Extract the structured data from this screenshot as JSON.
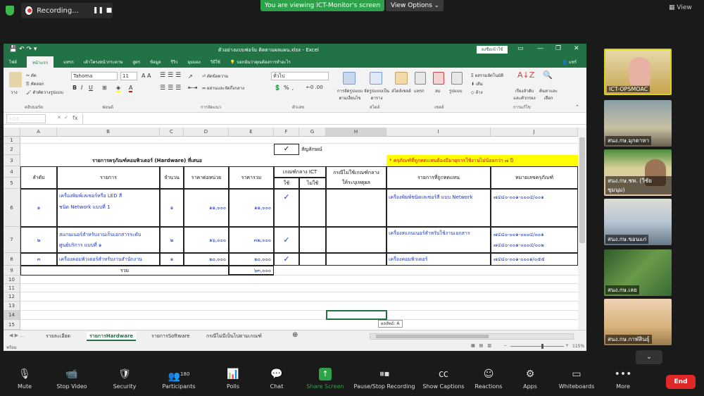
{
  "zoom": {
    "recording": "Recording...",
    "viewing_banner": "You are viewing ICT-Monitor's screen",
    "view_options": "View Options",
    "view_label": "View",
    "end": "End",
    "participants_count": "180"
  },
  "toolbar": [
    {
      "label": "Mute",
      "icon": "microphone-icon"
    },
    {
      "label": "Stop Video",
      "icon": "camera-icon"
    },
    {
      "label": "Security",
      "icon": "shield-icon"
    },
    {
      "label": "Participants",
      "icon": "people-icon"
    },
    {
      "label": "Polls",
      "icon": "polls-icon"
    },
    {
      "label": "Chat",
      "icon": "chat-icon"
    },
    {
      "label": "Share Screen",
      "icon": "share-icon"
    },
    {
      "label": "Pause/Stop Recording",
      "icon": "pause-icon"
    },
    {
      "label": "Show Captions",
      "icon": "cc-icon"
    },
    {
      "label": "Reactions",
      "icon": "emoji-icon"
    },
    {
      "label": "Apps",
      "icon": "apps-icon"
    },
    {
      "label": "Whiteboards",
      "icon": "whiteboard-icon"
    },
    {
      "label": "More",
      "icon": "more-icon"
    }
  ],
  "participants": [
    {
      "name": "ICT-OPSMOAC"
    },
    {
      "name": "สนง.กษ.มุกดาหา"
    },
    {
      "name": "สนง.กษ.ชพ. (วิชัย ชุมนุม)"
    },
    {
      "name": "สนง.กษ.ขอนแก่"
    },
    {
      "name": "สนง.กษ.เลย"
    },
    {
      "name": "สนง.กษ.กาฬสินธุ์"
    }
  ],
  "excel": {
    "title": "ตัวอย่างแบบฟอร์ม ติดตามผลแผน.xlsx - Excel",
    "signin": "ลงชื่อเข้าใช้",
    "tabs": [
      "ไฟล์",
      "หน้าแรก",
      "แทรก",
      "เค้าโครงหน้ากระดาษ",
      "สูตร",
      "ข้อมูล",
      "รีวิว",
      "มุมมอง",
      "วิธีใช้",
      "บอกฉันว่าคุณต้องการทำอะไร"
    ],
    "share": "แชร์",
    "font_name": "Tahoma",
    "font_size": "11",
    "ribbon_groups": [
      "คลิปบอร์ด",
      "ฟอนต์",
      "การจัดแนว",
      "ตัวเลข",
      "สไตล์",
      "เซลล์",
      "การแก้ไข"
    ],
    "ribbon_labels": {
      "paste": "วาง",
      "cut": "ตัด",
      "copy": "คัดลอก",
      "format_painter": "ตัวคัดวางรูปแบบ",
      "wrap": "ตัดข้อความ",
      "merge": "ผสานและจัดกึ่งกลาง",
      "number_format": "ทั่วไป",
      "cond_format": "การจัดรูปแบบตามเงื่อนไข",
      "table_format": "จัดรูปแบบเป็นตาราง",
      "cell_styles": "สไตล์เซลล์",
      "insert": "แทรก",
      "delete": "ลบ",
      "format": "รูปแบบ",
      "autosum": "ผลรวมอัตโนมัติ",
      "fill": "เติม",
      "clear": "ล้าง",
      "sort": "เรียงลำดับและตัวกรอง",
      "find": "ค้นหาและเลือก"
    },
    "namebox": "H14",
    "fx": "fx",
    "columns": [
      "A",
      "B",
      "C",
      "D",
      "E",
      "F",
      "G",
      "H",
      "I",
      "J"
    ],
    "rows": [
      "1",
      "2",
      "3",
      "4",
      "5",
      "6",
      "7",
      "8",
      "9",
      "10",
      "11",
      "12",
      "13",
      "14",
      "15"
    ],
    "legend_label": "สัญลักษณ์",
    "check": "✓",
    "header_title": "รายการครุภัณฑ์คอมพิวเตอร์ (Hardware) ที่เสนอ",
    "note": "* ครุภัณฑ์ที่ถูกทดแทนต้องมีอายุการใช้งานไม่น้อยกว่า ๗ ปี",
    "headers": {
      "no": "ลำดับ",
      "item": "รายการ",
      "qty": "จำนวน",
      "unit_price": "ราคาต่อหน่วย",
      "total": "ราคารวม",
      "ict": "เกณฑ์กลาง ICT",
      "use": "ใช้",
      "nouse": "ไม่ใช้",
      "case": "กรณีไม่ใช้เกณฑ์กลาง",
      "case2": "ให้ระบุเหตุผล",
      "replaced": "รายการที่ถูกทดแทน",
      "asset": "หมายเลขครุภัณฑ์"
    },
    "data": [
      {
        "no": "๑",
        "item1": "เครื่องพิมพ์เลเซอร์หรือ LED สี",
        "item2": "ชนิด Network  แบบที่ 1",
        "qty": "๑",
        "price": "๑๑,๐๐๐",
        "total": "๑๑,๐๐๐",
        "replaced": "เครื่องพิมพ์ชนิดเลเซอร์สี แบบ Network",
        "asset1": "๗๔๔๐-๐๐๑-๐๐๐๔/๐๐๑"
      },
      {
        "no": "๒",
        "item1": "สแกนเนอร์สำหรับงานเก็บเอกสารระดับ",
        "item2": "ศูนย์บริการ แบบที่ ๑",
        "qty": "๒",
        "price": "๑๖,๐๐๐",
        "total": "๓๒,๐๐๐",
        "replaced": "เครื่องสแกนเนอร์สำหรับใช้งานเอกสาร",
        "asset1": "๗๔๔๐-๐๐๑-๐๐๐๔/๐๐๑",
        "asset2": "๗๔๔๐-๐๐๑-๐๐๐๔/๐๐๒"
      },
      {
        "no": "๓",
        "item1": "เครื่องคอมพิวเตอร์สำหรับงานสำนักงาน",
        "item2": "",
        "qty": "๑",
        "price": "๒๐,๐๐๐",
        "total": "๒๐,๐๐๐",
        "replaced": "เครื่องคอมพิวเตอร์",
        "asset1": "๗๔๔๐-๐๐๑-๐๐๐๑/๐๕๕"
      }
    ],
    "sum_label": "รวม",
    "sum_value": "๖๓,๐๐๐",
    "tooltip": "ผลลัพธ์: A",
    "sheets": [
      "รายละเอียด",
      "รายการHardware",
      "รายการSoftware",
      "กรณีไม่มีเป็นไปตามเกณฑ์"
    ],
    "status_ready": "พร้อม",
    "zoom_level": "115%"
  }
}
